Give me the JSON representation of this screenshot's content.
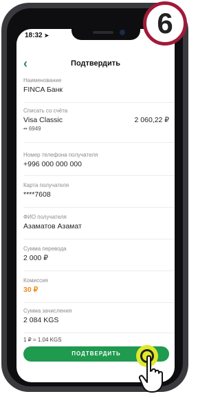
{
  "status_bar": {
    "time": "18:32",
    "location_icon": "location-arrow-icon"
  },
  "nav": {
    "title": "Подтвердить",
    "back_icon": "chevron-left-icon"
  },
  "fields": {
    "name": {
      "label": "Наименование",
      "value": "FINCA Банк"
    },
    "debit": {
      "label": "Списать со счёта",
      "value": "Visa Classic",
      "amount": "2 060,22 ₽",
      "card_tail": "•• 6949"
    },
    "phone": {
      "label": "Номер телефона получателя",
      "value": "+996 000 000 000"
    },
    "card": {
      "label": "Карта получателя",
      "value": "****7608"
    },
    "fio": {
      "label": "ФИО получателя",
      "value": "Азаматов Азамат"
    },
    "transfer_sum": {
      "label": "Сумма перевода",
      "value": "2 000 ₽"
    },
    "commission": {
      "label": "Комиссия",
      "value": "30 ₽"
    },
    "credit_sum": {
      "label": "Сумма зачисления",
      "value": "2 084 KGS"
    },
    "rate": "1 ₽ = 1.04 KGS"
  },
  "confirm_button": "ПОДТВЕРДИТЬ",
  "step_badge": "6",
  "colors": {
    "accent": "#1f9a4f",
    "commission": "#f08a1c",
    "badge_ring": "#a11a38",
    "tap": "#dfe92a"
  }
}
